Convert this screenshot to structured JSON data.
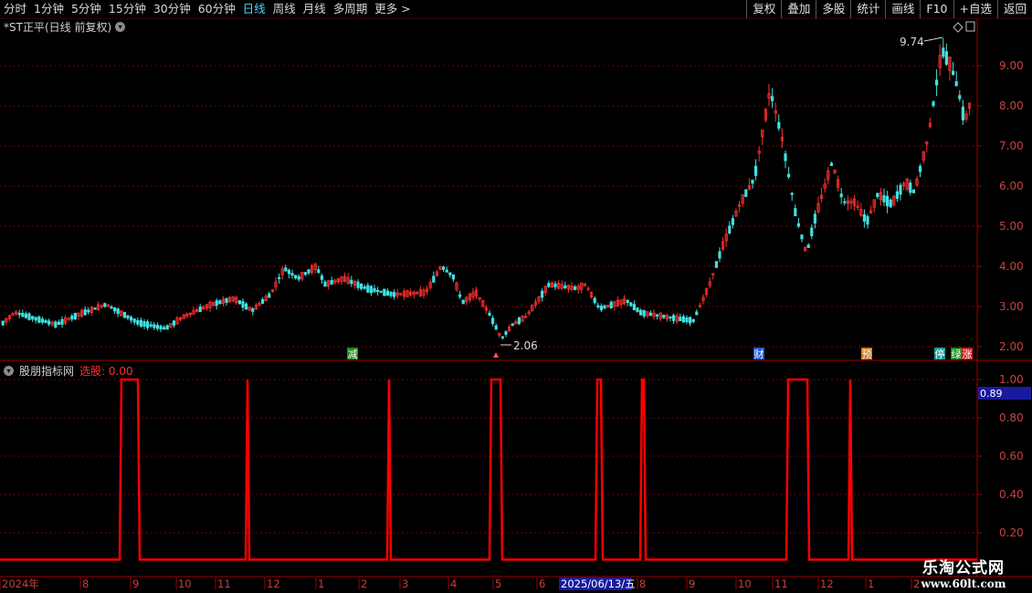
{
  "toolbar": {
    "periods": [
      {
        "label": "分时",
        "active": false
      },
      {
        "label": "1分钟",
        "active": false
      },
      {
        "label": "5分钟",
        "active": false
      },
      {
        "label": "15分钟",
        "active": false
      },
      {
        "label": "30分钟",
        "active": false
      },
      {
        "label": "60分钟",
        "active": false
      },
      {
        "label": "日线",
        "active": true
      },
      {
        "label": "周线",
        "active": false
      },
      {
        "label": "月线",
        "active": false
      },
      {
        "label": "多周期",
        "active": false
      },
      {
        "label": "更多 >",
        "active": false
      }
    ],
    "right_buttons": [
      "复权",
      "叠加",
      "多股",
      "统计",
      "画线",
      "F10",
      "+自选",
      "返回"
    ]
  },
  "main_chart": {
    "title": "*ST正平(日线 前复权)",
    "y_ticks": [
      "9.00",
      "8.00",
      "7.00",
      "6.00",
      "5.00",
      "4.00",
      "3.00",
      "2.00"
    ],
    "high_label": "9.74",
    "low_label": "2.06",
    "markers": [
      {
        "text": "减",
        "color": "#1a8a1a"
      },
      {
        "text": "财",
        "color": "#1a5ad0"
      },
      {
        "text": "预",
        "color": "#c87820"
      },
      {
        "text": "停",
        "color": "#1a9a9a"
      },
      {
        "text": "绿",
        "color": "#1a8a1a"
      },
      {
        "text": "涨",
        "color": "#c82020"
      }
    ]
  },
  "indicator": {
    "name": "股朋指标网",
    "select_label": "选股: 0.00",
    "y_ticks": [
      "1.00",
      "0.80",
      "0.60",
      "0.40",
      "0.20"
    ],
    "current_value": "0.89"
  },
  "x_axis": {
    "labels": [
      "2024年",
      "8",
      "9",
      "10",
      "11",
      "12",
      "1",
      "2",
      "3",
      "4",
      "5",
      "6",
      "2025/06/13/五",
      "8",
      "9",
      "10",
      "11",
      "12",
      "1",
      "2"
    ]
  },
  "watermark": {
    "line1": "乐淘公式网",
    "line2": "www.60lt.com"
  },
  "colors": {
    "up": "#ff3030",
    "down": "#40e0e0",
    "grid": "#7a0000",
    "signal": "#ff0000"
  },
  "chart_data": {
    "type": "bar",
    "price_range": [
      1.8,
      9.9
    ],
    "key_prices": {
      "high": 9.74,
      "low": 2.06
    },
    "signal_range": [
      0,
      1
    ]
  }
}
